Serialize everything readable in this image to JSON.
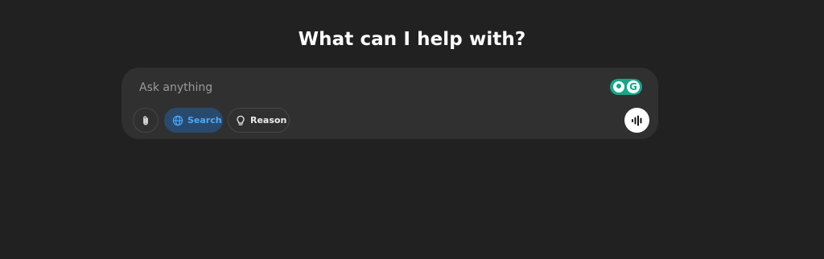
{
  "heading": "What can I help with?",
  "composer": {
    "placeholder": "Ask anything",
    "value": "",
    "grammarly_letter": "G"
  },
  "toolbar": {
    "search_label": "Search",
    "reason_label": "Reason"
  },
  "icons": {
    "attach": "paperclip-icon",
    "search": "globe-icon",
    "reason": "lightbulb-icon",
    "voice": "voice-waveform-icon",
    "grammarly": "grammarly-icon"
  },
  "colors": {
    "background": "#212121",
    "composer": "#303030",
    "search_active_bg": "#2a4a6d",
    "search_active_text": "#48aaff",
    "grammarly": "#14a889"
  }
}
